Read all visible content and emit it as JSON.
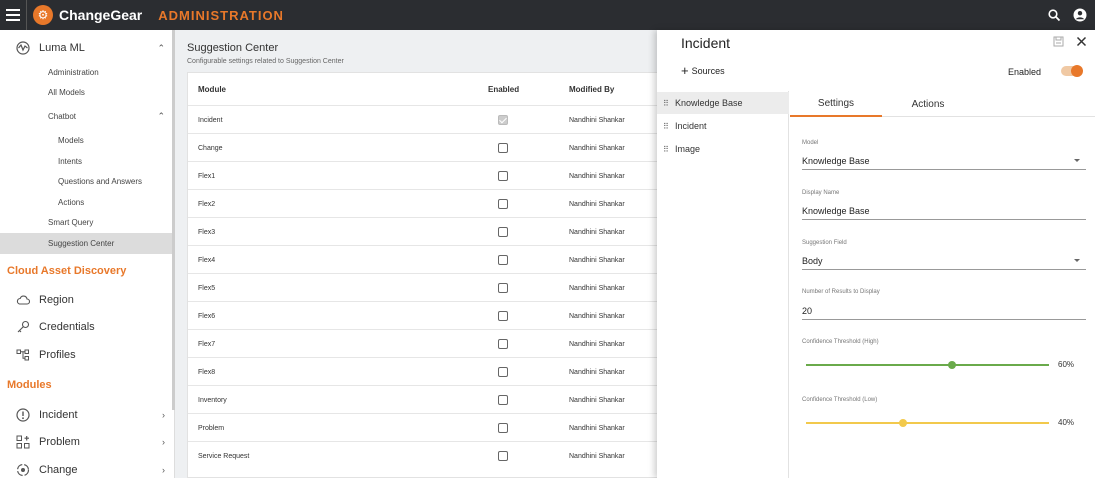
{
  "topbar": {
    "brand": "ChangeGear",
    "section": "ADMINISTRATION",
    "accent_color": "#e8782a"
  },
  "sidebar": {
    "luma_ml": "Luma ML",
    "items_l2": {
      "administration": "Administration",
      "all_models": "All Models",
      "chatbot": "Chatbot",
      "models": "Models",
      "intents": "Intents",
      "qa": "Questions and Answers",
      "actions": "Actions",
      "smart_query": "Smart Query",
      "suggestion_center": "Suggestion Center"
    },
    "cloud_asset_discovery": "Cloud Asset Discovery",
    "cad_items": {
      "region": "Region",
      "credentials": "Credentials",
      "profiles": "Profiles"
    },
    "modules_heading": "Modules",
    "modules": {
      "incident": "Incident",
      "problem": "Problem",
      "change": "Change"
    }
  },
  "main": {
    "title": "Suggestion Center",
    "subtitle": "Configurable settings related to Suggestion Center",
    "columns": {
      "module": "Module",
      "enabled": "Enabled",
      "modified_by": "Modified By"
    },
    "rows": [
      {
        "module": "Incident",
        "enabled": true,
        "modified_by": "Nandhini Shankar"
      },
      {
        "module": "Change",
        "enabled": false,
        "modified_by": "Nandhini Shankar"
      },
      {
        "module": "Flex1",
        "enabled": false,
        "modified_by": "Nandhini Shankar"
      },
      {
        "module": "Flex2",
        "enabled": false,
        "modified_by": "Nandhini Shankar"
      },
      {
        "module": "Flex3",
        "enabled": false,
        "modified_by": "Nandhini Shankar"
      },
      {
        "module": "Flex4",
        "enabled": false,
        "modified_by": "Nandhini Shankar"
      },
      {
        "module": "Flex5",
        "enabled": false,
        "modified_by": "Nandhini Shankar"
      },
      {
        "module": "Flex6",
        "enabled": false,
        "modified_by": "Nandhini Shankar"
      },
      {
        "module": "Flex7",
        "enabled": false,
        "modified_by": "Nandhini Shankar"
      },
      {
        "module": "Flex8",
        "enabled": false,
        "modified_by": "Nandhini Shankar"
      },
      {
        "module": "Inventory",
        "enabled": false,
        "modified_by": "Nandhini Shankar"
      },
      {
        "module": "Problem",
        "enabled": false,
        "modified_by": "Nandhini Shankar"
      },
      {
        "module": "Service Request",
        "enabled": false,
        "modified_by": "Nandhini Shankar"
      }
    ]
  },
  "panel": {
    "title": "Incident",
    "sources_label": "Sources",
    "enabled_label": "Enabled",
    "enabled": true,
    "sources": [
      "Knowledge Base",
      "Incident",
      "Image"
    ],
    "tabs": {
      "settings": "Settings",
      "actions": "Actions"
    },
    "fields": {
      "model_label": "Model",
      "model_value": "Knowledge Base",
      "display_name_label": "Display Name",
      "display_name_value": "Knowledge Base",
      "suggestion_field_label": "Suggestion Field",
      "suggestion_field_value": "Body",
      "num_results_label": "Number of Results to Display",
      "num_results_value": "20",
      "conf_high_label": "Confidence Threshold (High)",
      "conf_high_value": "60%",
      "conf_high_color": "#6aaa4b",
      "conf_low_label": "Confidence Threshold (Low)",
      "conf_low_value": "40%",
      "conf_low_color": "#f2c94c"
    }
  }
}
